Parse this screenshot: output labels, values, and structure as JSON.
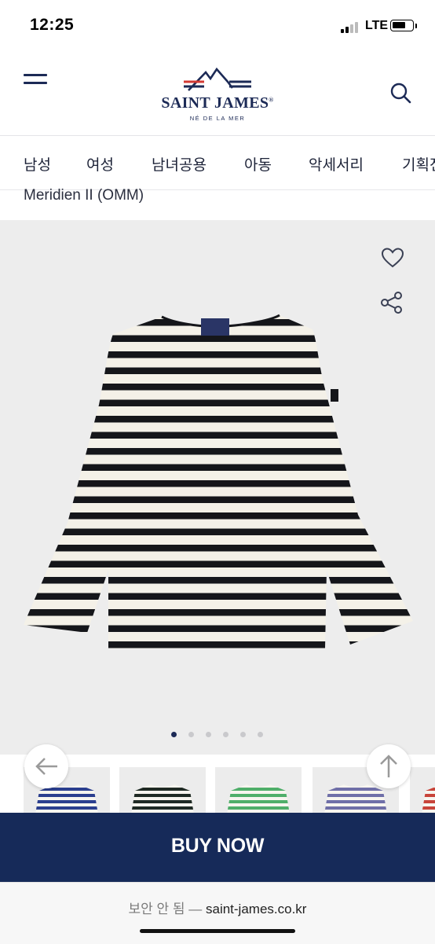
{
  "status_bar": {
    "time": "12:25",
    "network": "LTE",
    "battery_level": 0.65
  },
  "header": {
    "brand": "SAINT JAMES",
    "registered": "®",
    "tagline": "NÉ DE LA MER",
    "menu_icon": "hamburger-icon",
    "search_icon": "search-icon"
  },
  "categories": [
    "남성",
    "여성",
    "남녀공용",
    "아동",
    "악세서리",
    "기획전"
  ],
  "product": {
    "title": "Meridien II (OMM)"
  },
  "gallery": {
    "wishlist_icon": "heart-icon",
    "share_icon": "share-icon",
    "slide_count": 6,
    "active_slide": 1
  },
  "thumbnails": [
    {
      "stripe_color": "#2b3f8f"
    },
    {
      "stripe_color": "#1f2a24"
    },
    {
      "stripe_color": "#4fae6a"
    },
    {
      "stripe_color": "#6f6fa8"
    },
    {
      "stripe_color": "#c8443a"
    }
  ],
  "buttons": {
    "back_icon": "arrow-left-icon",
    "top_icon": "arrow-up-icon"
  },
  "cta": {
    "label": "BUY NOW",
    "color": "#162a59"
  },
  "browser": {
    "security": "보안 안 됨 —",
    "domain": "saint-james.co.kr"
  }
}
